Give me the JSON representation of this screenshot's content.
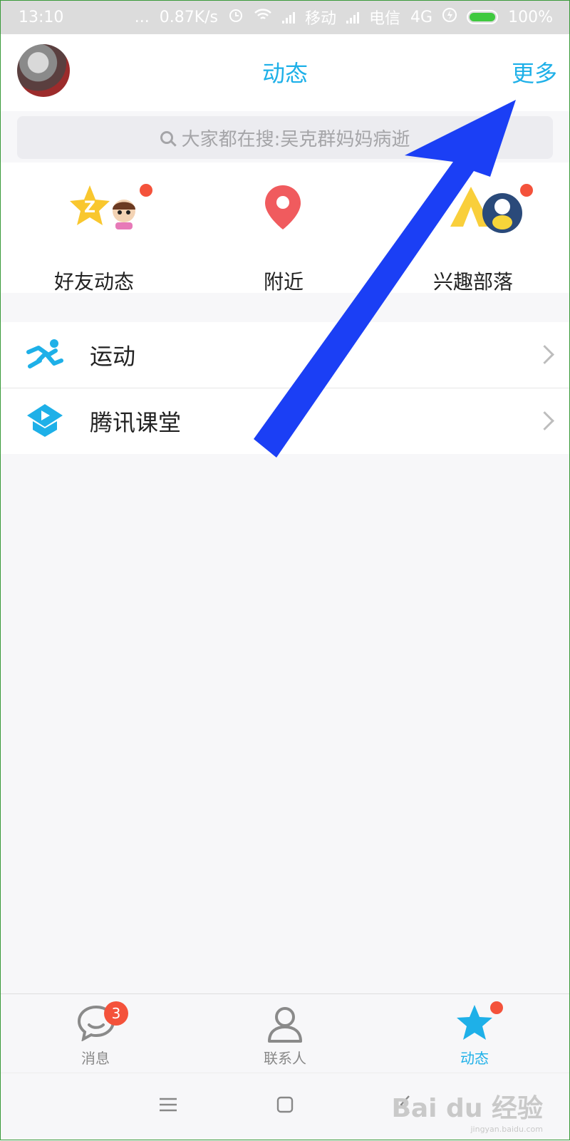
{
  "status_bar": {
    "time": "13:10",
    "dots": "...",
    "speed": "0.87K/s",
    "carrier1": "移动",
    "carrier2": "电信",
    "network": "4G",
    "battery": "100%"
  },
  "header": {
    "title": "动态",
    "more": "更多"
  },
  "search": {
    "placeholder": "大家都在搜:吴克群妈妈病逝"
  },
  "quick_entries": [
    {
      "label": "好友动态",
      "icon": "qzone-star-icon"
    },
    {
      "label": "附近",
      "icon": "location-pin-icon"
    },
    {
      "label": "兴趣部落",
      "icon": "tribe-tent-icon"
    }
  ],
  "list": [
    {
      "label": "运动",
      "icon": "running-icon"
    },
    {
      "label": "腾讯课堂",
      "icon": "tencent-classroom-icon"
    }
  ],
  "tabbar": {
    "tabs": [
      {
        "label": "消息",
        "icon": "chat-bubble-icon",
        "badge": "3",
        "active": false
      },
      {
        "label": "联系人",
        "icon": "contact-person-icon",
        "active": false
      },
      {
        "label": "动态",
        "icon": "star-icon",
        "active": true
      }
    ]
  },
  "watermark": {
    "main": "Bai du 经验",
    "sub": "jingyan.baidu.com"
  },
  "colors": {
    "accent": "#1eb0e8",
    "badge": "#f4523b",
    "arrow": "#1b3ff5"
  }
}
